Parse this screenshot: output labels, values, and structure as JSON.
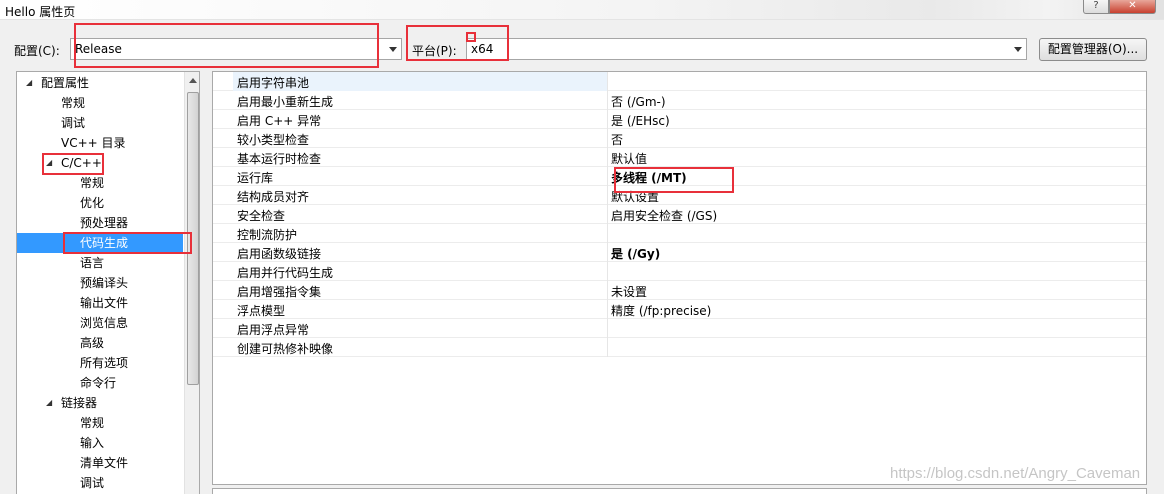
{
  "window": {
    "title": "Hello 属性页",
    "help_label": "?",
    "close_label": "✕"
  },
  "toolbar": {
    "config_label": "配置(C):",
    "config_value": "Release",
    "platform_label": "平台(P):",
    "platform_value": "x64",
    "config_manager_label": "配置管理器(O)..."
  },
  "tree": {
    "items": [
      {
        "label": "配置属性",
        "expanded": true
      },
      {
        "label": "常规"
      },
      {
        "label": "调试"
      },
      {
        "label": "VC++ 目录"
      },
      {
        "label": "C/C++",
        "expanded": true
      },
      {
        "label": "常规"
      },
      {
        "label": "优化"
      },
      {
        "label": "预处理器"
      },
      {
        "label": "代码生成",
        "selected": true
      },
      {
        "label": "语言"
      },
      {
        "label": "预编译头"
      },
      {
        "label": "输出文件"
      },
      {
        "label": "浏览信息"
      },
      {
        "label": "高级"
      },
      {
        "label": "所有选项"
      },
      {
        "label": "命令行"
      },
      {
        "label": "链接器",
        "expanded": true
      },
      {
        "label": "常规"
      },
      {
        "label": "输入"
      },
      {
        "label": "清单文件"
      },
      {
        "label": "调试"
      }
    ]
  },
  "properties": [
    {
      "name": "启用字符串池",
      "value": ""
    },
    {
      "name": "启用最小重新生成",
      "value": "否 (/Gm-)"
    },
    {
      "name": "启用 C++ 异常",
      "value": "是 (/EHsc)"
    },
    {
      "name": "较小类型检查",
      "value": "否"
    },
    {
      "name": "基本运行时检查",
      "value": "默认值"
    },
    {
      "name": "运行库",
      "value": "多线程 (/MT)",
      "bold": true
    },
    {
      "name": "结构成员对齐",
      "value": "默认设置"
    },
    {
      "name": "安全检查",
      "value": "启用安全检查 (/GS)"
    },
    {
      "name": "控制流防护",
      "value": ""
    },
    {
      "name": "启用函数级链接",
      "value": "是 (/Gy)",
      "bold": true
    },
    {
      "name": "启用并行代码生成",
      "value": ""
    },
    {
      "name": "启用增强指令集",
      "value": "未设置"
    },
    {
      "name": "浮点模型",
      "value": "精度 (/fp:precise)"
    },
    {
      "name": "启用浮点异常",
      "value": ""
    },
    {
      "name": "创建可热修补映像",
      "value": ""
    }
  ],
  "watermark": "https://blog.csdn.net/Angry_Caveman",
  "colors": {
    "selection": "#3399ff",
    "highlight_box": "#e8303a"
  }
}
